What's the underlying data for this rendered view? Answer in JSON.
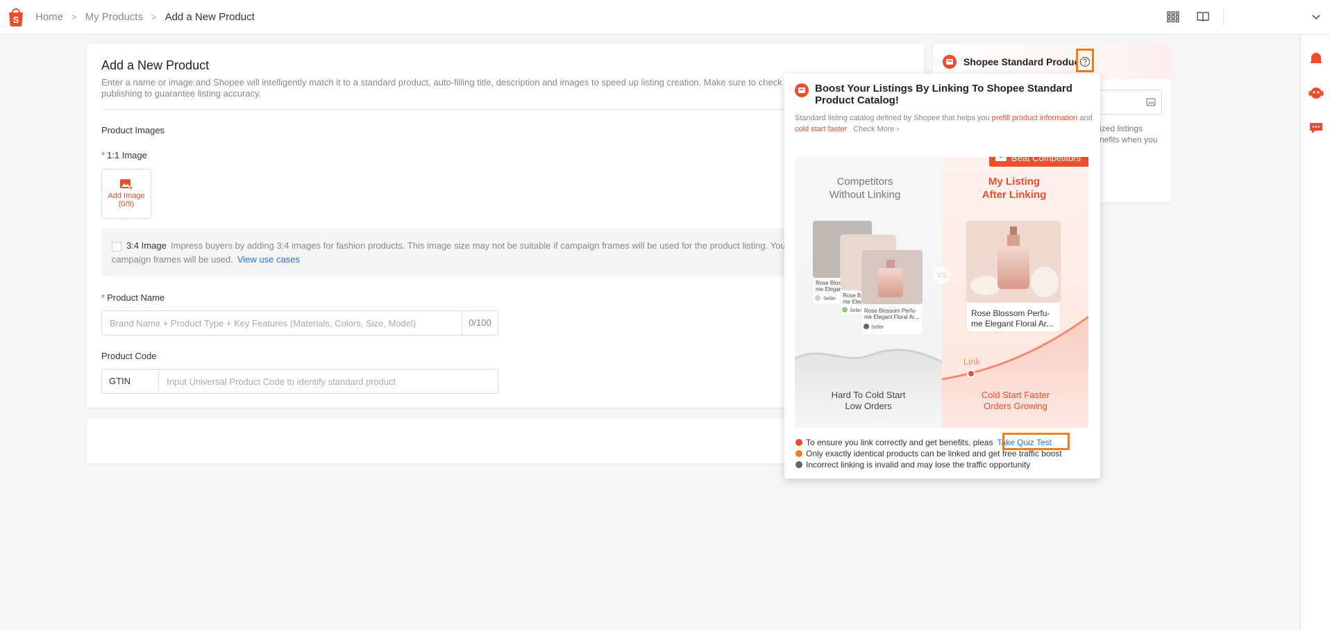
{
  "colors": {
    "brand": "#ee4d2d",
    "link": "#2673dd",
    "highlight": "#f27b1b"
  },
  "breadcrumb": {
    "home": "Home",
    "products": "My Products",
    "current": "Add a New Product"
  },
  "form": {
    "title": "Add a New Product",
    "description": "Enter a name or image and Shopee will intelligently match it to a standard product, auto-filling title, description and images to speed up listing creation. Make sure to check and fi",
    "description_line2": "publishing to guarantee listing accuracy.",
    "product_images_label": "Product Images",
    "image_1_1_label": "1:1 Image",
    "add_image_label": "Add Image",
    "add_image_count": "(0/9)",
    "notice_title": "3:4 Image",
    "notice_text": "Impress buyers by adding 3:4 images for fashion products. This image size may not be suitable if campaign frames will be used for the product listing. You may",
    "notice_text2": "campaign frames will be used.",
    "notice_link": "View use cases",
    "product_name_label": "Product Name",
    "product_name_placeholder": "Brand Name + Product Type + Key Features (Materials, Colors, Size, Model)",
    "product_name_count": "0/100",
    "product_code_label": "Product Code",
    "gtin_label": "GTIN",
    "gtin_placeholder": "Input Universal Product Code to identify standard product"
  },
  "side_panel": {
    "title": "Shopee Standard Product",
    "frag1": "ized listings",
    "frag2": "nefits when you"
  },
  "popover": {
    "title": "Boost Your Listings By Linking To Shopee Standard Product Catalog!",
    "desc_a": "Standard listing catalog defined by Shopee that helps you ",
    "desc_hl1": "prefill product information",
    "desc_b": " and ",
    "desc_hl2": "cold start faster",
    "check_more": "Check More",
    "badge": "Beat Competitors",
    "left_heading_1": "Competitors",
    "left_heading_2": "Without Linking",
    "right_heading_1": "My Listing",
    "right_heading_2": "After Linking",
    "vs": "VS",
    "product_name_1": "Rose Blossom Perfu-",
    "product_name_2": "me Elegant Floral Ar...",
    "small_card_1": "Rose Bloss",
    "small_card_1b": "me Elegan",
    "small_card_2": "Rose Bl",
    "small_card_2b": "me Eleg",
    "small_card_3": "Rose Blossom Perfu-",
    "small_card_3b": "me Elegant Floral Ar...",
    "seller": "Seller",
    "link_label": "Link",
    "left_footer_1": "Hard To Cold Start",
    "left_footer_2": "Low Orders",
    "right_footer_1": "Cold Start Faster",
    "right_footer_2": "Orders Growing",
    "note1": "To ensure you link correctly and get benefits, pleas",
    "quiz": "Take Quiz Test",
    "note2": "Only exactly identical products can be linked and get free traffic boost",
    "note3": "Incorrect linking is invalid and may lose the traffic opportunity"
  },
  "icons": [
    "shopee-logo-icon",
    "apps-grid-icon",
    "book-icon",
    "chevron-down-icon",
    "bell-icon",
    "support-icon",
    "chat-icon",
    "help-icon",
    "image-search-icon"
  ]
}
